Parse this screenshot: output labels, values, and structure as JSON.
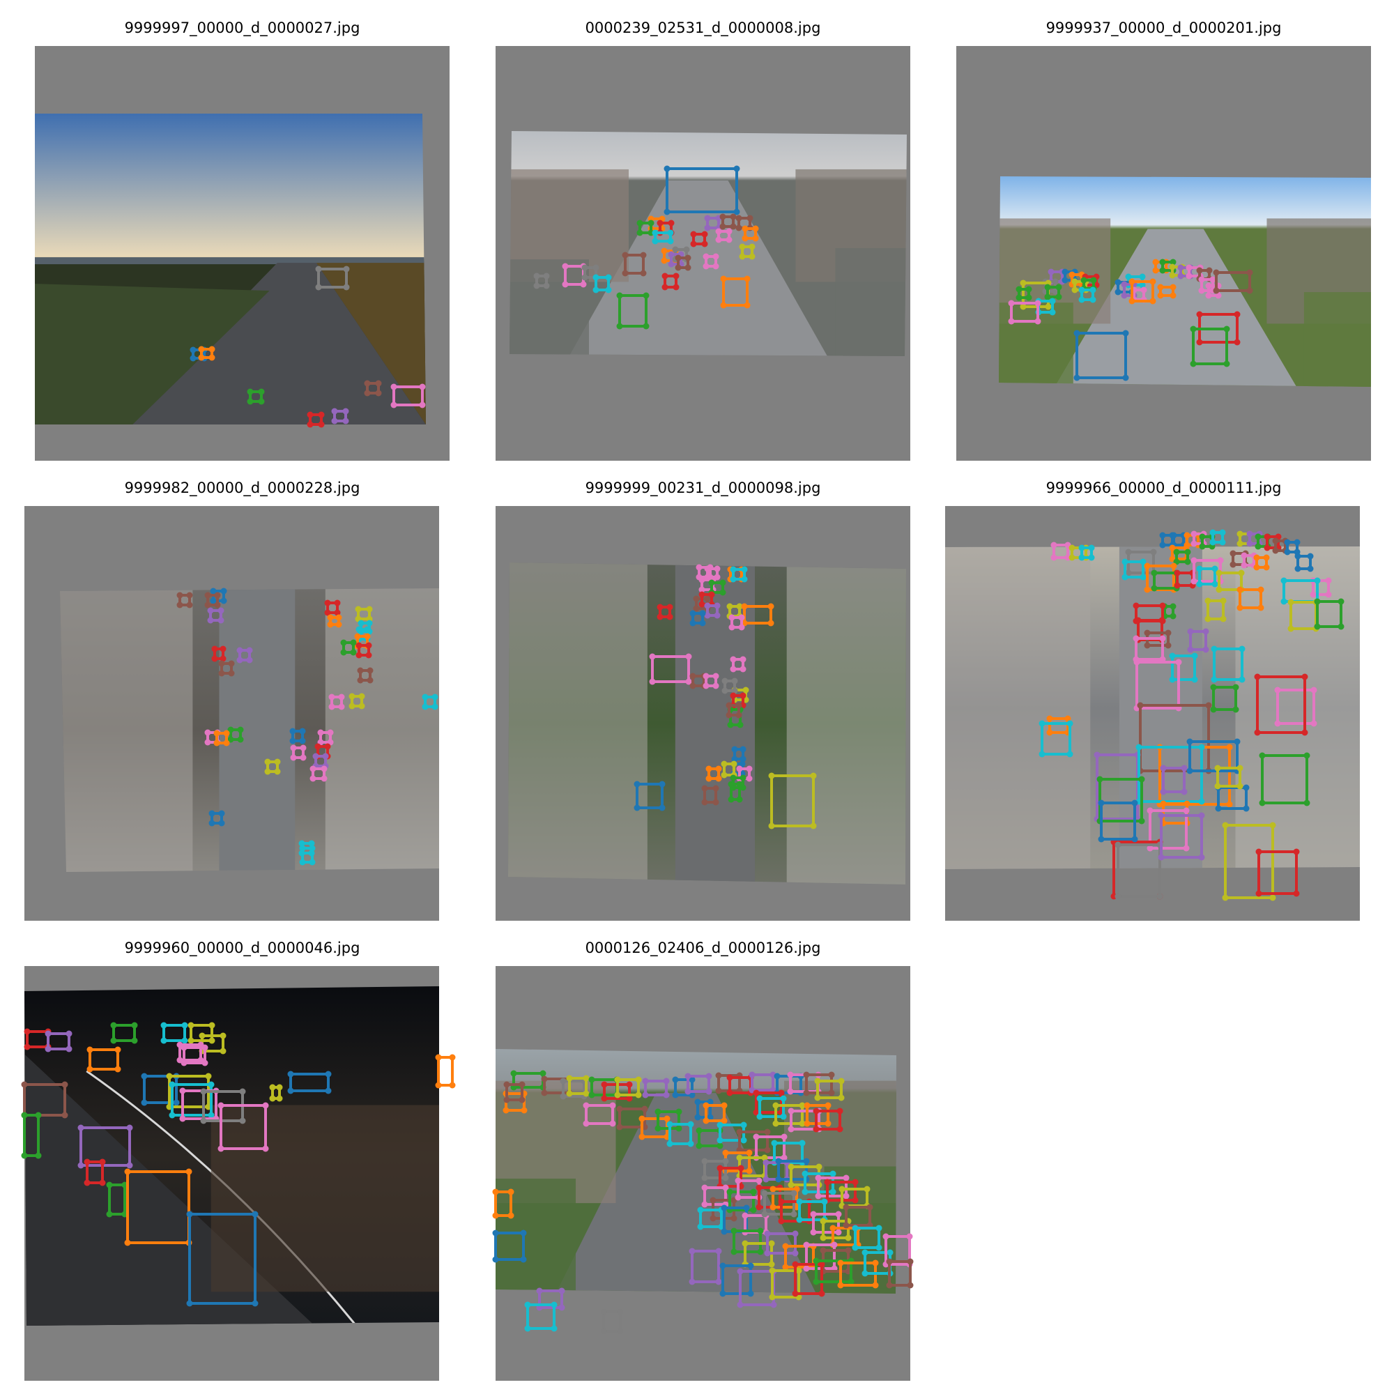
{
  "palette": {
    "letterbox": "#808080",
    "box_colors": [
      "#1f77b4",
      "#ff7f0e",
      "#2ca02c",
      "#d62728",
      "#9467bd",
      "#8c564b",
      "#e377c2",
      "#7f7f7f",
      "#bcbd22",
      "#17becf"
    ]
  },
  "panels": [
    {
      "title": "9999997_00000_d_0000027.jpg",
      "photo": {
        "sky_top": "#3f6fb0",
        "sky_bottom": "#e9d9b8",
        "ground": "#2c3522",
        "road": "#4a4c50"
      }
    },
    {
      "title": "0000239_02531_d_0000008.jpg",
      "photo": {
        "sky_top": "#b9bdc2",
        "sky_bottom": "#cfcfcf",
        "ground": "#6b6f6b",
        "road": "#8f9194"
      }
    },
    {
      "title": "9999937_00000_d_0000201.jpg",
      "photo": {
        "sky_top": "#7fb3e8",
        "sky_bottom": "#dfeaf3",
        "ground": "#5f7a3e",
        "road": "#9a9ea3"
      }
    },
    {
      "title": "9999982_00000_d_0000228.jpg",
      "photo": {
        "sky_top": "#6e6d6a",
        "sky_bottom": "#8a8883",
        "ground": "#5d5a55",
        "road": "#777a7d"
      }
    },
    {
      "title": "9999999_00231_d_0000098.jpg",
      "photo": {
        "sky_top": "#5a5f56",
        "sky_bottom": "#6d7066",
        "ground": "#3f5a32",
        "road": "#6a6c6e"
      }
    },
    {
      "title": "9999966_00000_d_0000111.jpg",
      "photo": {
        "sky_top": "#b7b3a8",
        "sky_bottom": "#9a9890",
        "ground": "#7d7f82",
        "road": "#8b8d90"
      }
    },
    {
      "title": "9999960_00000_d_0000046.jpg",
      "photo": {
        "sky_top": "#0a0c10",
        "sky_bottom": "#15181c",
        "ground": "#2a2622",
        "road": "#2f3033"
      }
    },
    {
      "title": "0000126_02406_d_0000126.jpg",
      "photo": {
        "sky_top": "#9aa3a8",
        "sky_bottom": "#8e9497",
        "ground": "#4f6e3c",
        "road": "#6f7275"
      }
    }
  ]
}
